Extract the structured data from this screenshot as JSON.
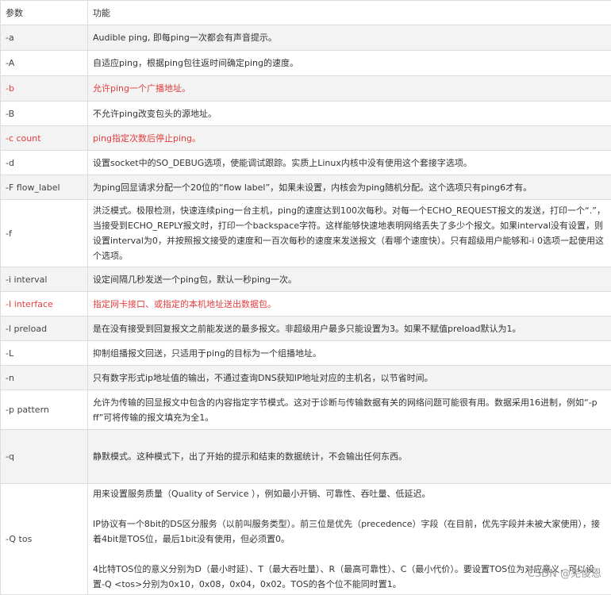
{
  "header": {
    "param": "参数",
    "function": "功能"
  },
  "rows": [
    {
      "param": "-a",
      "desc": "Audible ping, 即每ping一次都会有声音提示。"
    },
    {
      "param": "-A",
      "desc": "自适应ping，根据ping包往返时间确定ping的速度。"
    },
    {
      "param": "-b",
      "desc": "允许ping一个广播地址。"
    },
    {
      "param": "-B",
      "desc": "不允许ping改变包头的源地址。"
    },
    {
      "param": "-c count",
      "desc": "ping指定次数后停止ping。"
    },
    {
      "param": "-d",
      "desc": "设置socket中的SO_DEBUG选项，使能调试跟踪。实质上Linux内核中没有使用这个套接字选项。"
    },
    {
      "param": "-F flow_label",
      "desc": "为ping回显请求分配一个20位的“flow label”，如果未设置，内核会为ping随机分配。这个选项只有ping6才有。"
    },
    {
      "param": "-f",
      "desc": "洪泛模式。极限检测，快速连续ping一台主机，ping的速度达到100次每秒。对每一个ECHO_REQUEST报文的发送，打印一个“.”，当接受到ECHO_REPLY报文时，打印一个backspace字符。这样能够快速地表明网络丢失了多少个报文。如果interval没有设置，则设置interval为0，并按照报文接受的速度和一百次每秒的速度来发送报文（看哪个速度快）。只有超级用户能够和-i 0选项一起使用这个选项。"
    },
    {
      "param": "-i interval",
      "desc": "设定间隔几秒发送一个ping包，默认一秒ping一次。"
    },
    {
      "param": "-I interface",
      "desc": "指定网卡接口、或指定的本机地址送出数据包。"
    },
    {
      "param": "-l preload",
      "desc": "是在没有接受到回复报文之前能发送的最多报文。非超级用户最多只能设置为3。如果不赋值preload默认为1。"
    },
    {
      "param": "-L",
      "desc": "抑制组播报文回送，只适用于ping的目标为一个组播地址。"
    },
    {
      "param": "-n",
      "desc": "只有数字形式ip地址值的输出，不通过查询DNS获知IP地址对应的主机名，以节省时间。"
    },
    {
      "param": "-p pattern",
      "desc": "允许为传输的回显报文中包含的内容指定字节模式。这对于诊断与传输数据有关的网络问题可能很有用。数据采用16进制，例如“-p ff”可将传输的报文填充为全1。"
    },
    {
      "param": "-q",
      "desc": "静默模式。这种模式下，出了开始的提示和结束的数据统计，不会输出任何东西。"
    },
    {
      "param": "-Q tos",
      "desc_p1": "用来设置服务质量（Quality of Service ），例如最小开销、可靠性、吞吐量、低延迟。",
      "desc_p2": "IP协议有一个8bit的DS区分服务（以前叫服务类型）。前三位是优先（precedence）字段（在目前，优先字段并未被大家使用），接着4bit是TOS位，最后1bit没有使用，但必须置0。",
      "desc_p3": "4比特TOS位的意义分别为D（最小时延）、T（最大吞吐量）、R（最高可靠性）、C（最小代价）。要设置TOS位为对应意义，可以设置-Q <tos>分别为0x10，0x08，0x04，0x02。TOS的各个位不能同时置1。"
    }
  ],
  "watermark": "CSDN @羌俊恩",
  "colors": {
    "highlight": "#e23d3d",
    "stripe": "#f3f3f3",
    "border": "#dcdcdc"
  }
}
